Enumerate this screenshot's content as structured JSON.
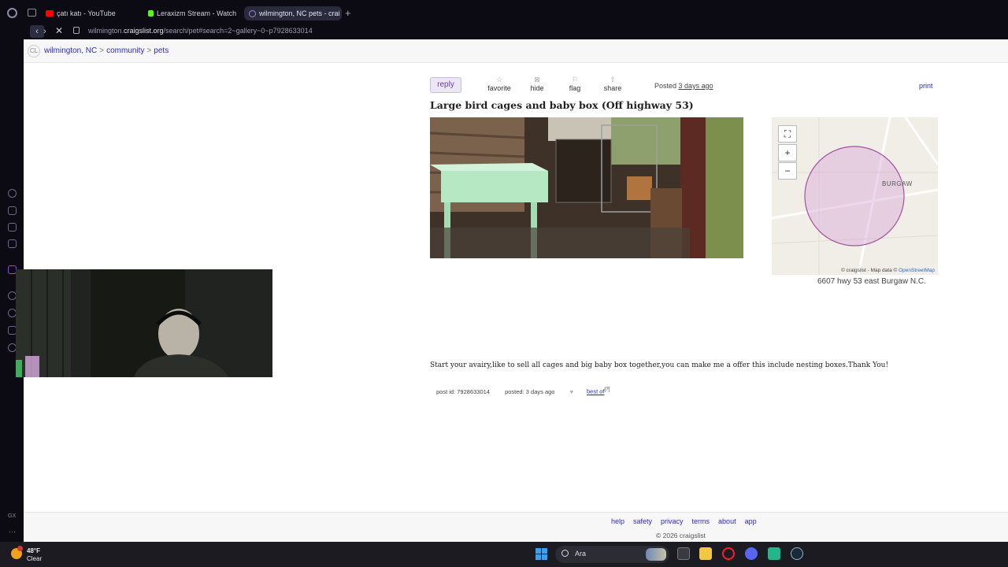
{
  "browser": {
    "tabs": [
      {
        "label": "çatı katı - YouTube",
        "favicon_color": "#ff0000"
      },
      {
        "label": "Leraxizm Stream - Watch",
        "favicon_color": "#53fc18"
      },
      {
        "label": "wilmington, NC pets - crai",
        "favicon_color": "#7a7aa8"
      }
    ],
    "url_prefix": "wilmington.",
    "url_domain": "craigslist.org",
    "url_path": "/search/pet#search=2~gallery~0~p7928633014"
  },
  "breadcrumb": {
    "logo": "CL",
    "items": [
      "wilmington, NC",
      "community",
      "pets"
    ],
    "separator": ">"
  },
  "post": {
    "reply_label": "reply",
    "actions": [
      {
        "label": "favorite",
        "icon": "star-icon",
        "glyph": "☆"
      },
      {
        "label": "hide",
        "icon": "hide-icon",
        "glyph": "⊠"
      },
      {
        "label": "flag",
        "icon": "flag-icon",
        "glyph": "⚐"
      },
      {
        "label": "share",
        "icon": "share-icon",
        "glyph": "⇧"
      }
    ],
    "posted_prefix": "Posted",
    "posted_ago": "3 days ago",
    "print_label": "print",
    "title": "Large bird cages and baby box (Off highway 53)",
    "body": "Start your avairy,like to sell all cages and big baby box together,you can make me a offer this include nesting boxes.Thank You!",
    "post_id": "post id: 7928633014",
    "posted_meta": "posted: 3 days ago",
    "best_of": "best of",
    "best_of_sup": "[?]"
  },
  "map": {
    "place_label": "BURGAW",
    "attribution_prefix": "© craigslist - Map data ©",
    "attribution_link": "OpenStreetMap",
    "address": "6607 hwy 53 east Burgaw N.C.",
    "controls": [
      "⛶",
      "+",
      "−"
    ]
  },
  "footer": {
    "links": [
      "help",
      "safety",
      "privacy",
      "terms",
      "about",
      "app"
    ],
    "copyright": "© 2026 craigslist"
  },
  "taskbar": {
    "temperature": "48°F",
    "condition": "Clear",
    "search_label": "Ara"
  }
}
